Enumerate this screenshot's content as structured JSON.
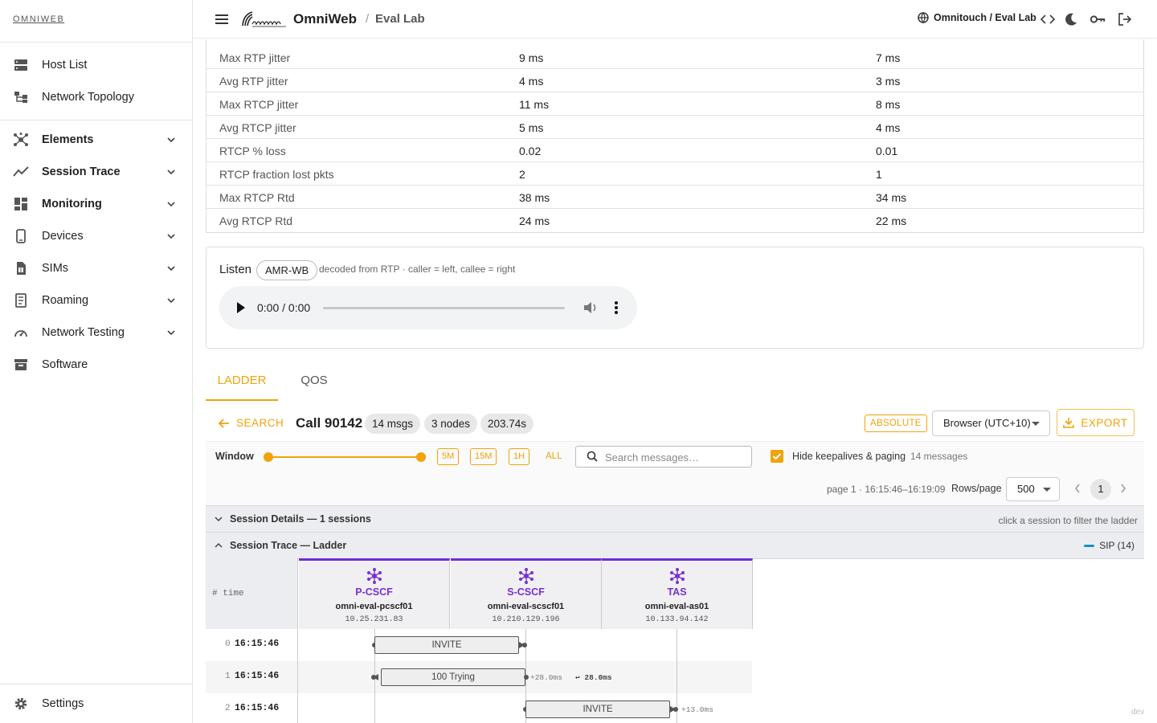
{
  "sidebar": {
    "brand": "OMNIWEB",
    "items": [
      {
        "label": "Host List",
        "icon": "host-list-icon",
        "bold": false,
        "expandable": false
      },
      {
        "label": "Network Topology",
        "icon": "topology-icon",
        "bold": false,
        "expandable": false
      },
      {
        "label": "Elements",
        "icon": "elements-icon",
        "bold": true,
        "expandable": true
      },
      {
        "label": "Session Trace",
        "icon": "trace-icon",
        "bold": true,
        "expandable": true
      },
      {
        "label": "Monitoring",
        "icon": "dashboard-icon",
        "bold": true,
        "expandable": true
      },
      {
        "label": "Devices",
        "icon": "phone-icon",
        "bold": false,
        "expandable": true
      },
      {
        "label": "SIMs",
        "icon": "sim-icon",
        "bold": false,
        "expandable": true
      },
      {
        "label": "Roaming",
        "icon": "roaming-icon",
        "bold": false,
        "expandable": true
      },
      {
        "label": "Network Testing",
        "icon": "speedometer-icon",
        "bold": false,
        "expandable": true
      },
      {
        "label": "Software",
        "icon": "archive-icon",
        "bold": false,
        "expandable": false
      }
    ],
    "settings_label": "Settings"
  },
  "topbar": {
    "app_title": "OmniWeb",
    "crumb_sep": "/",
    "crumb": "Eval Lab",
    "tenant": "Omnitouch / Eval Lab"
  },
  "stats": {
    "rows": [
      {
        "metric": "Max RTP jitter",
        "caller": "9 ms",
        "callee": "7 ms"
      },
      {
        "metric": "Avg RTP jitter",
        "caller": "4 ms",
        "callee": "3 ms"
      },
      {
        "metric": "Max RTCP jitter",
        "caller": "11 ms",
        "callee": "8 ms"
      },
      {
        "metric": "Avg RTCP jitter",
        "caller": "5 ms",
        "callee": "4 ms"
      },
      {
        "metric": "RTCP % loss",
        "caller": "0.02",
        "callee": "0.01"
      },
      {
        "metric": "RTCP fraction lost pkts",
        "caller": "2",
        "callee": "1"
      },
      {
        "metric": "Max RTCP Rtd",
        "caller": "38 ms",
        "callee": "34 ms"
      },
      {
        "metric": "Avg RTCP Rtd",
        "caller": "24 ms",
        "callee": "22 ms"
      }
    ]
  },
  "listen": {
    "label": "Listen",
    "codec": "AMR-WB",
    "note": "decoded from RTP · caller = left, callee = right",
    "time": "0:00 / 0:00"
  },
  "tabs": [
    {
      "label": "LADDER",
      "active": true
    },
    {
      "label": "QOS",
      "active": false
    }
  ],
  "toolbar": {
    "back_label": "SEARCH",
    "call_title": "Call 90142",
    "pills": [
      "14 msgs",
      "3 nodes",
      "203.74s"
    ],
    "time_mode": "ABSOLUTE",
    "timezone": "Browser (UTC+10)",
    "export_label": "EXPORT"
  },
  "filters": {
    "window_label": "Window",
    "ranges": [
      "5M",
      "15M",
      "1H"
    ],
    "all_label": "ALL",
    "search_placeholder": "Search messages…",
    "search_value": "",
    "hide_keepalives_label": "Hide keepalives & paging",
    "hide_keepalives_checked": true,
    "message_count": "14 messages"
  },
  "pager": {
    "info": "page 1 · 16:15:46–16:19:09",
    "rows_label": "Rows/page",
    "rows_value": "500",
    "current_page": "1"
  },
  "sections": {
    "details_title": "Session Details — 1 sessions",
    "details_hint": "click a session to filter the ladder",
    "ladder_title": "Session Trace — Ladder",
    "legend": "SIP (14)"
  },
  "ladder": {
    "corner_label": "#  time",
    "nodes": [
      {
        "type": "P-CSCF",
        "name": "omni-eval-pcscf01",
        "ip": "10.25.231.83"
      },
      {
        "type": "S-CSCF",
        "name": "omni-eval-scscf01",
        "ip": "10.210.129.196"
      },
      {
        "type": "TAS",
        "name": "omni-eval-as01",
        "ip": "10.133.94.142"
      }
    ],
    "messages": [
      {
        "idx": "0",
        "time": "16:15:46",
        "label": "INVITE",
        "delta": "",
        "rtt": ""
      },
      {
        "idx": "1",
        "time": "16:15:46",
        "label": "100 Trying",
        "delta": "+28.0ms",
        "rtt": "↩ 28.0ms"
      },
      {
        "idx": "2",
        "time": "16:15:46",
        "label": "INVITE",
        "delta": "+13.0ms",
        "rtt": ""
      }
    ]
  },
  "footer": {
    "env": "dev"
  },
  "colors": {
    "accent": "#f0a30a",
    "node_purple": "#6a2fd6",
    "sip_blue": "#1a8fc0"
  }
}
